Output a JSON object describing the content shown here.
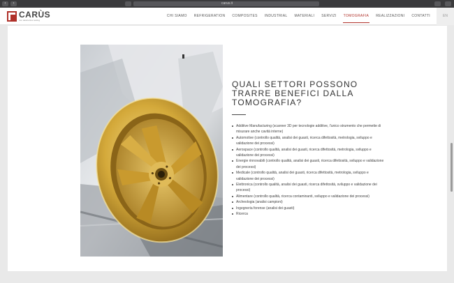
{
  "browser": {
    "url": "carus.it",
    "back_icon": "chevron-left-icon",
    "forward_icon": "chevron-right-icon"
  },
  "header": {
    "logo_name": "CARÙS",
    "logo_sub": "non destructive testing",
    "nav": [
      {
        "label": "CHI SIAMO",
        "active": false
      },
      {
        "label": "REFRIGERATION",
        "active": false
      },
      {
        "label": "COMPOSITES",
        "active": false
      },
      {
        "label": "INDUSTRIAL",
        "active": false
      },
      {
        "label": "MATERIALI",
        "active": false
      },
      {
        "label": "SERVIZI",
        "active": false
      },
      {
        "label": "TOMOGRAFIA",
        "active": true
      },
      {
        "label": "REALIZZAZIONI",
        "active": false
      },
      {
        "label": "CONTATTI",
        "active": false
      }
    ],
    "lang": "EN"
  },
  "main": {
    "title_lines": [
      "QUALI SETTORI POSSONO",
      "TRARRE BENEFICI DALLA",
      "TOMOGRAFIA?"
    ],
    "sectors": [
      "Additive Manufacturing (scanner 3D per tecnologie additive, l'unico strumento che permette di misurare anche cavità interne)",
      "Automotive (controllo qualità, analisi dei guasti, ricerca difettosità, metrologia, sviluppo e validazione dei processi)",
      "Aerospace (controllo qualità, analisi dei guasti, ricerca difettosità, metrologia, sviluppo e validazione dei processi)",
      "Energie rinnovabili (controllo qualità, analisi dei guasti, ricerca difettosità, sviluppo e validazione dei processi)",
      "Medicale (controllo qualità, analisi dei guasti, ricerca difettosità, metrologia, sviluppo e validazione dei processi)",
      "Elettronica (controllo qualità, analisi dei guasti, ricerca difettosità, sviluppo e validazione dei processi)",
      "Alimentare (controllo qualità, ricerca contaminanti, sviluppo e validazione dei processi)",
      "Archeologia (analisi campioni)",
      "Ingegneria forense (analisi dei guasti)",
      "Ricerca"
    ]
  },
  "colors": {
    "brand": "#b0312a",
    "wheel": "#d4a93a"
  }
}
